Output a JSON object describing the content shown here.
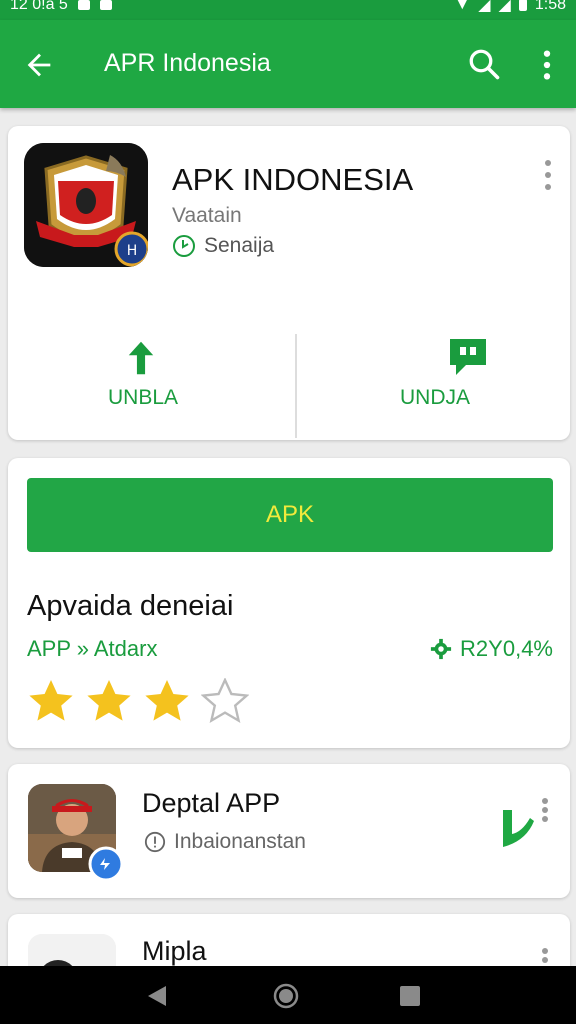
{
  "status_bar": {
    "time_left": "12 0!a 5",
    "time_right": "1:58"
  },
  "app_bar": {
    "title": "APR Indonesia"
  },
  "app": {
    "name": "APK INDONESIA",
    "developer": "Vaatain",
    "meta": "Senaija",
    "actions": [
      {
        "label": "UNBLA",
        "icon": "upload-arrow-icon"
      },
      {
        "label": "UNDJA",
        "icon": "chat-bubble-icon"
      }
    ]
  },
  "apk_card": {
    "button_label": "APK",
    "heading": "Apvaida deneiai",
    "subtitle": "APP » Atdarx",
    "stat": "R2Y0,4%",
    "rating": 3,
    "max_rating": 4
  },
  "list": [
    {
      "title": "Deptal APP",
      "subtitle": "Inbaionanstan"
    },
    {
      "title": "Mipla",
      "subtitle": ""
    }
  ],
  "colors": {
    "brand_green": "#1fa843",
    "accent_yellow": "#f2ea3c",
    "star": "#f4c21e"
  }
}
